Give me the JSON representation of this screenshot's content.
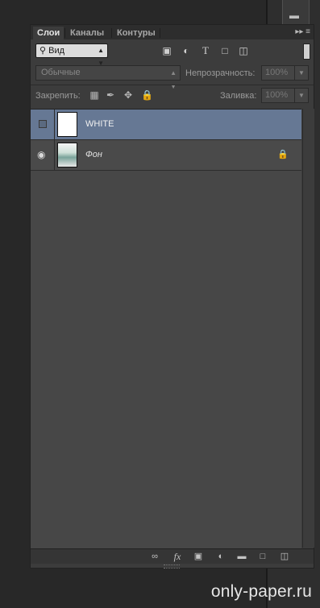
{
  "tabs": [
    {
      "label": "Слои",
      "active": true
    },
    {
      "label": "Каналы",
      "active": false
    },
    {
      "label": "Контуры",
      "active": false
    }
  ],
  "panel_menu_icon": "panel-menu-icon",
  "filter": {
    "label": "Вид",
    "icon": "search-icon"
  },
  "filter_icons": [
    "image-filter-icon",
    "adjustment-filter-icon",
    "type-filter-icon",
    "shape-filter-icon",
    "smart-object-filter-icon"
  ],
  "blend_mode": "Обычные",
  "opacity": {
    "label": "Непрозрачность:",
    "value": "100%"
  },
  "lock": {
    "label": "Закрепить:",
    "icons": [
      "lock-transparent-icon",
      "lock-image-icon",
      "lock-position-icon",
      "lock-all-icon"
    ]
  },
  "fill": {
    "label": "Заливка:",
    "value": "100%"
  },
  "layers": [
    {
      "name": "WHITE",
      "visible": false,
      "selected": true,
      "locked": false,
      "thumbnail": "white"
    },
    {
      "name": "Фон",
      "visible": true,
      "selected": false,
      "locked": true,
      "thumbnail": "photo"
    }
  ],
  "bottom_icons": [
    "link-icon",
    "fx-icon",
    "mask-icon",
    "adjustment-icon",
    "folder-icon",
    "new-layer-icon",
    "trash-icon"
  ],
  "bottom_labels": {
    "fx": "fx"
  },
  "watermark": "only-paper.ru",
  "colors": {
    "selected_layer": "#667894",
    "panel_bg": "#3c3c3c",
    "app_bg": "#282828"
  }
}
